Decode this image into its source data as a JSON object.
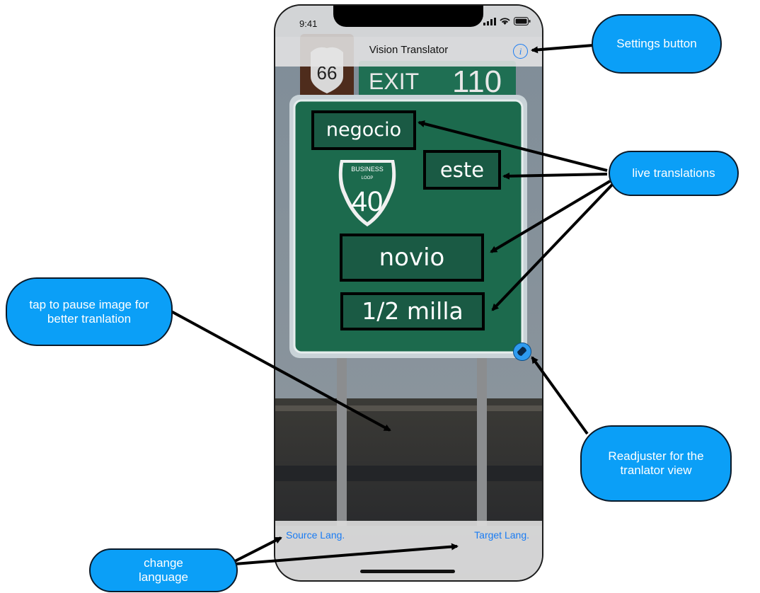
{
  "status_bar": {
    "time": "9:41"
  },
  "nav": {
    "title": "Vision Translator",
    "info_icon": "info-circle-icon"
  },
  "sign": {
    "route": "66",
    "exit_label": "EXIT",
    "exit_number": "110",
    "shield_top": "BUSINESS",
    "shield_mid": "LOOP",
    "shield_number": "40"
  },
  "translations": [
    "negocio",
    "este",
    "novio",
    "1/2 milla"
  ],
  "bottom_bar": {
    "source_label": "Source Lang.",
    "target_label": "Target Lang."
  },
  "annotations": {
    "settings": "Settings button",
    "live": "live translations",
    "pause": "tap to pause image for better tranlation",
    "readjust": "Readjuster for the tranlator view",
    "language": "change language"
  },
  "colors": {
    "accent": "#1a7cf3",
    "callout": "#0b9ff7",
    "sign_green": "#1a6b4c"
  }
}
